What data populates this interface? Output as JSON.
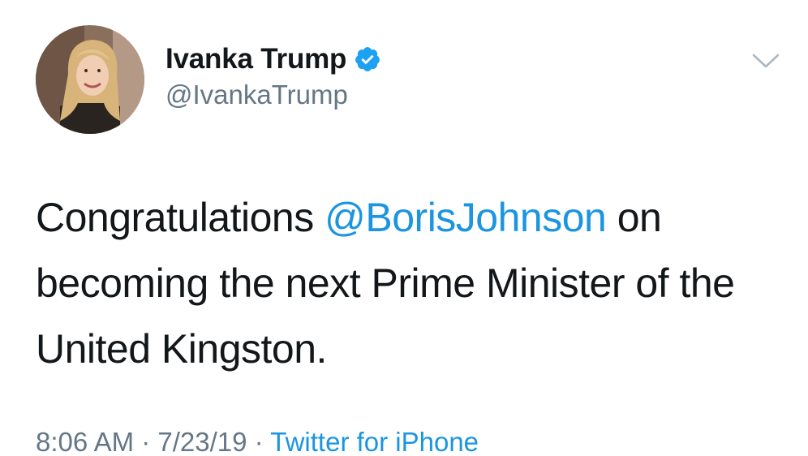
{
  "tweet": {
    "author": {
      "display_name": "Ivanka Trump",
      "handle": "@IvankaTrump",
      "verified": true,
      "avatar_icon": "profile-photo"
    },
    "body": {
      "text_before": "Congratulations ",
      "mention": "@BorisJohnson",
      "text_after": " on becoming the next Prime Minister of the United Kingston."
    },
    "meta": {
      "time": "8:06 AM",
      "separator_1": " · ",
      "date": "7/23/19",
      "separator_2": " · ",
      "source": "Twitter for iPhone"
    },
    "icons": {
      "verified": "verified-badge-icon",
      "menu": "chevron-down-icon"
    },
    "colors": {
      "text": "#14171a",
      "secondary": "#657786",
      "link": "#1b95e0",
      "verified": "#1da1f2"
    }
  }
}
